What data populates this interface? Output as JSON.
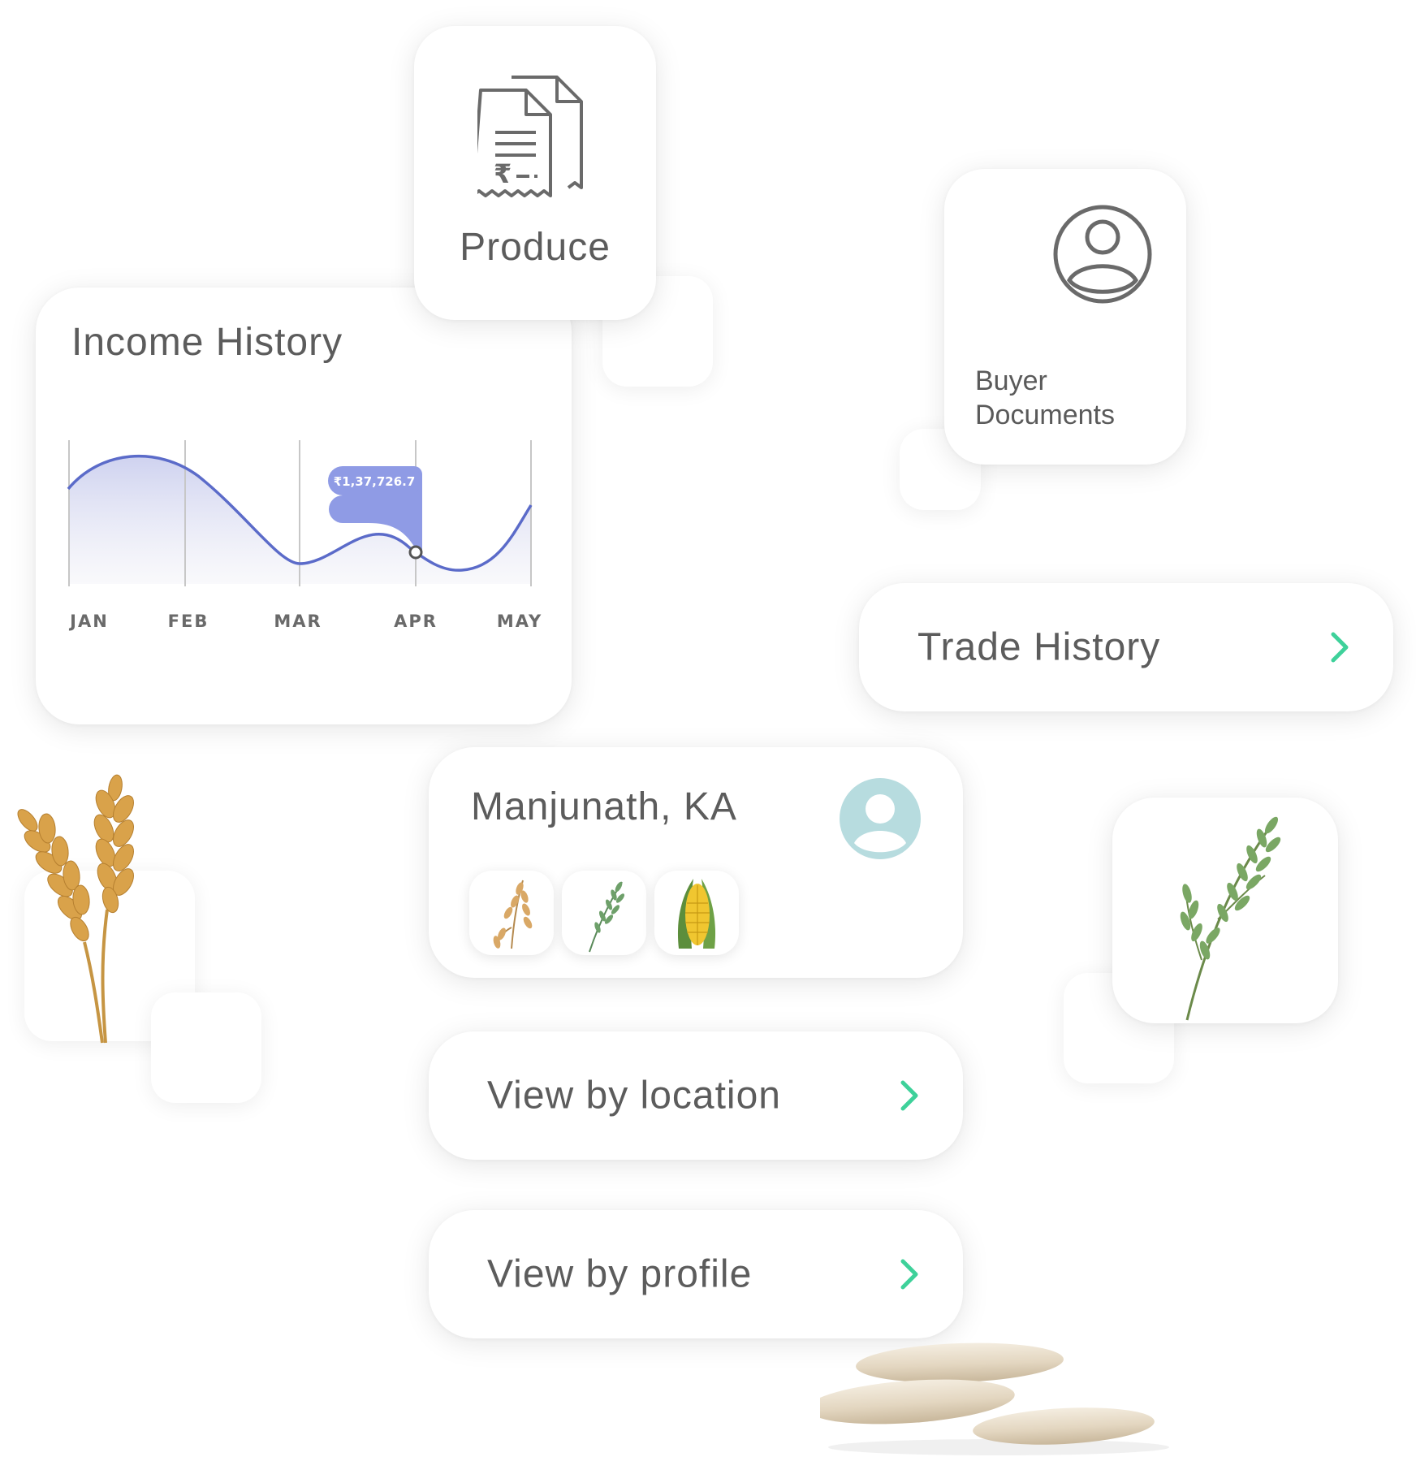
{
  "income_history": {
    "title": "Income History",
    "tooltip_value": "₹1,37,726.7",
    "colors": {
      "line": "#5b6bc9",
      "fill": "#c9cdee",
      "tooltip": "#8f9be5"
    },
    "chart_data": {
      "type": "area",
      "categories": [
        "JAN",
        "FEB",
        "MAR",
        "APR",
        "MAY"
      ],
      "highlighted_category": "APR",
      "tooltip_label": "₹1,37,726.7",
      "grid": "vertical"
    }
  },
  "produce": {
    "label": "Produce",
    "icon": "invoice-receipt-icon"
  },
  "buyer_documents": {
    "label_line1": "Buyer",
    "label_line2": "Documents",
    "icon": "user-circle-icon"
  },
  "trade_history": {
    "label": "Trade History",
    "icon": "chevron-right-icon",
    "accent": "#3ed19a"
  },
  "farmer": {
    "name": "Manjunath, KA",
    "avatar_color": "#b7dcdf",
    "crops": [
      "oat-icon",
      "rice-plant-icon",
      "corn-icon"
    ]
  },
  "view_by_location": {
    "label": "View by location",
    "icon": "chevron-right-icon"
  },
  "view_by_profile": {
    "label": "View by profile",
    "icon": "chevron-right-icon"
  }
}
